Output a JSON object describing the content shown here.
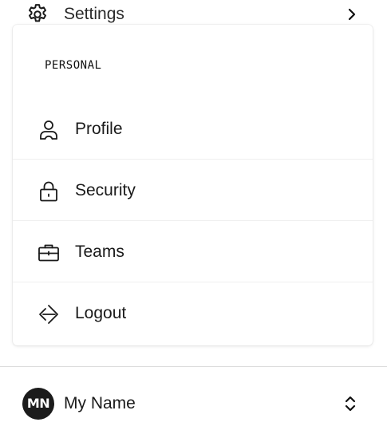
{
  "settings": {
    "label": "Settings",
    "icon": "gear-icon",
    "chevron_icon": "chevron-right-icon"
  },
  "menu": {
    "section_label": "PERSONAL",
    "items": [
      {
        "label": "Profile",
        "icon": "user-icon"
      },
      {
        "label": "Security",
        "icon": "lock-icon"
      },
      {
        "label": "Teams",
        "icon": "briefcase-icon"
      },
      {
        "label": "Logout",
        "icon": "logout-icon"
      }
    ]
  },
  "user": {
    "initials": "MN",
    "name": "My Name",
    "switcher_icon": "chevron-up-down-icon"
  },
  "colors": {
    "text": "#1a1a1a",
    "avatar_bg": "#1b1b1b",
    "divider": "#efefef",
    "separator": "#dcdcdc"
  }
}
